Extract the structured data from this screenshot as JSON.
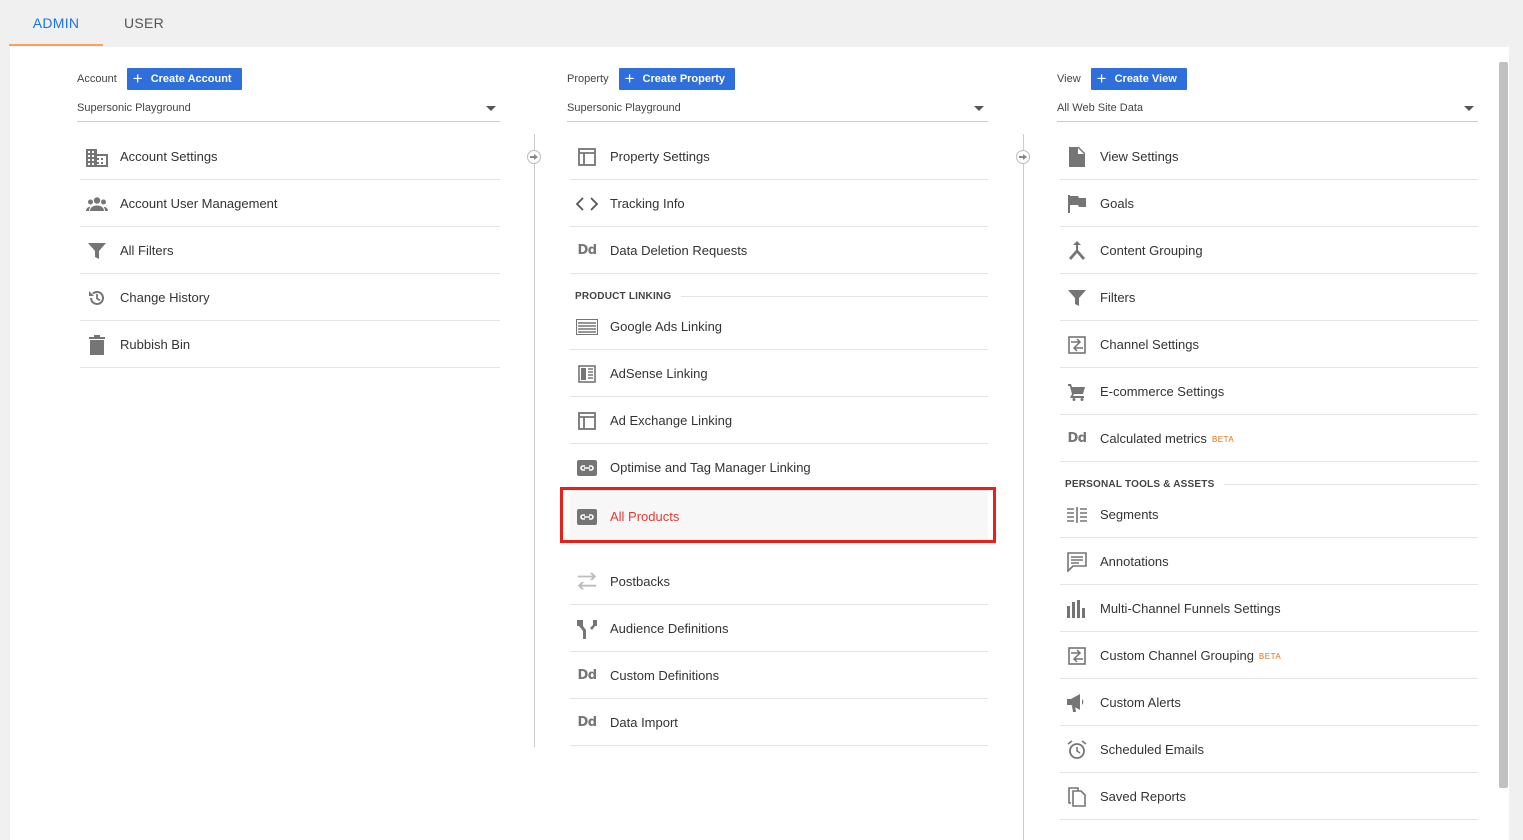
{
  "tabs": {
    "admin": "ADMIN",
    "user": "USER"
  },
  "account": {
    "label": "Account",
    "create_label": "Create Account",
    "selected": "Supersonic Playground",
    "items": [
      {
        "label": "Account Settings",
        "icon": "building-icon"
      },
      {
        "label": "Account User Management",
        "icon": "people-icon"
      },
      {
        "label": "All Filters",
        "icon": "filter-icon"
      },
      {
        "label": "Change History",
        "icon": "history-icon"
      },
      {
        "label": "Rubbish Bin",
        "icon": "trash-icon"
      }
    ]
  },
  "property": {
    "label": "Property",
    "create_label": "Create Property",
    "selected": "Supersonic Playground",
    "items": [
      {
        "label": "Property Settings",
        "icon": "window-icon"
      },
      {
        "label": "Tracking Info",
        "icon": "code-icon"
      },
      {
        "label": "Data Deletion Requests",
        "icon": "dd-icon",
        "glyph": "Dd"
      }
    ],
    "section_label": "PRODUCT LINKING",
    "linking_items": [
      {
        "label": "Google Ads Linking",
        "icon": "ads-icon"
      },
      {
        "label": "AdSense Linking",
        "icon": "adsense-icon"
      },
      {
        "label": "Ad Exchange Linking",
        "icon": "window-icon"
      },
      {
        "label": "Optimise and Tag Manager Linking",
        "icon": "link-icon"
      },
      {
        "label": "All Products",
        "icon": "link-icon"
      }
    ],
    "more_items": [
      {
        "label": "Postbacks",
        "icon": "postback-icon"
      },
      {
        "label": "Audience Definitions",
        "icon": "audience-icon"
      },
      {
        "label": "Custom Definitions",
        "icon": "dd-icon",
        "glyph": "Dd"
      },
      {
        "label": "Data Import",
        "icon": "dd-icon",
        "glyph": "Dd"
      }
    ]
  },
  "view": {
    "label": "View",
    "create_label": "Create View",
    "selected": "All Web Site Data",
    "items": [
      {
        "label": "View Settings",
        "icon": "document-icon"
      },
      {
        "label": "Goals",
        "icon": "flag-icon"
      },
      {
        "label": "Content Grouping",
        "icon": "grouping-icon"
      },
      {
        "label": "Filters",
        "icon": "filter-icon"
      },
      {
        "label": "Channel Settings",
        "icon": "channel-icon"
      },
      {
        "label": "E-commerce Settings",
        "icon": "cart-icon"
      },
      {
        "label": "Calculated metrics",
        "icon": "dd-icon",
        "glyph": "Dd",
        "badge": "BETA"
      }
    ],
    "section_label": "PERSONAL TOOLS & ASSETS",
    "tool_items": [
      {
        "label": "Segments",
        "icon": "segments-icon"
      },
      {
        "label": "Annotations",
        "icon": "annotation-icon"
      },
      {
        "label": "Multi-Channel Funnels Settings",
        "icon": "barchart-icon"
      },
      {
        "label": "Custom Channel Grouping",
        "icon": "channel-icon",
        "badge": "BETA"
      },
      {
        "label": "Custom Alerts",
        "icon": "megaphone-icon"
      },
      {
        "label": "Scheduled Emails",
        "icon": "alarm-icon"
      },
      {
        "label": "Saved Reports",
        "icon": "copy-icon"
      }
    ]
  },
  "colors": {
    "accent": "#1a73e8",
    "button": "#2e6fdc",
    "highlight": "#e53935",
    "beta": "#e8710a"
  }
}
